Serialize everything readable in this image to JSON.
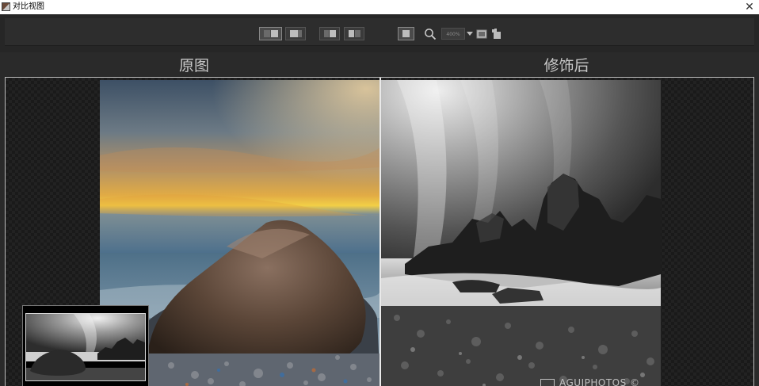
{
  "window": {
    "title": "对比视图",
    "close_glyph": "✕"
  },
  "toolbar": {
    "view_modes": [
      "side-by-side-left",
      "single-before",
      "split-vertical",
      "split-vertical-alt"
    ],
    "zoom_value": "400%",
    "icons": [
      "side-by-side-icon",
      "single-view-icon",
      "split-view-icon",
      "split-view-alt-icon",
      "fit-window-icon",
      "zoom-icon",
      "zoom-dropdown-icon",
      "compare-icon",
      "hand-icon"
    ]
  },
  "labels": {
    "before": "原图",
    "after": "修饰后"
  },
  "watermark": "AGUIPHOTOS ©",
  "colors": {
    "background": "#2a2a2a",
    "toolbar": "#262626",
    "label": "#c9c9c9",
    "divider": "#e9e9e9"
  }
}
